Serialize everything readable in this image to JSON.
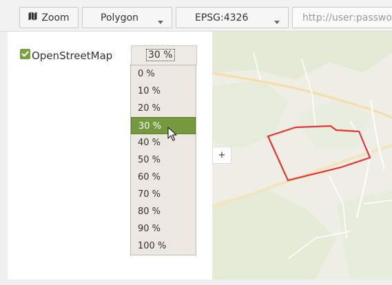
{
  "toolbar": {
    "zoom_label": "Zoom",
    "geometry_select": "Polygon",
    "projection_select": "EPSG:4326",
    "url_placeholder": "http://user:password"
  },
  "layers": {
    "items": [
      {
        "label": "OpenStreetMap",
        "checked": true,
        "opacity": "30 %"
      }
    ]
  },
  "opacity_options": [
    "0 %",
    "10 %",
    "20 %",
    "30 %",
    "40 %",
    "50 %",
    "60 %",
    "70 %",
    "80 %",
    "90 %",
    "100 %"
  ],
  "selected_opacity_index": 3,
  "map": {
    "zoom_in_label": "+"
  },
  "colors": {
    "accent_green": "#76993f",
    "polygon_stroke": "#e8332d"
  }
}
